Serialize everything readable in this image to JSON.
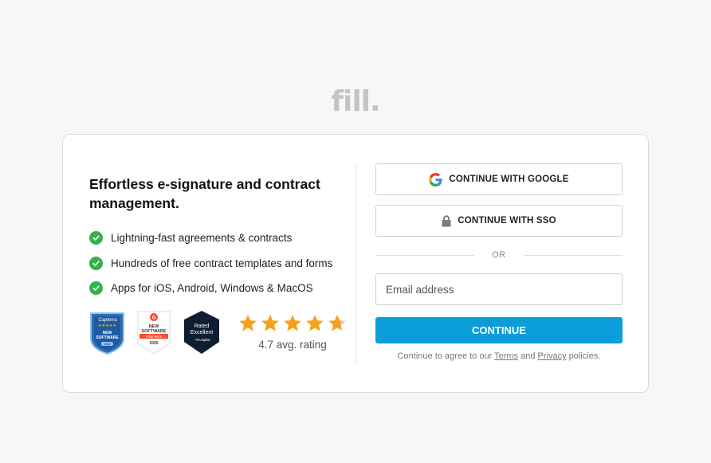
{
  "logo": {
    "text": "fill."
  },
  "headline": "Effortless e-signature and contract management.",
  "features": [
    "Lightning-fast agreements & contracts",
    "Hundreds of free contract templates and forms",
    "Apps for iOS, Android, Windows & MacOS"
  ],
  "badges": {
    "capterra": {
      "brand": "Capterra",
      "line1": "NEW",
      "line2": "SOFTWARE",
      "year": "2024"
    },
    "g2": {
      "line1": "NEW",
      "line2": "SOFTWARE",
      "category": "eSignature",
      "year": "2025"
    },
    "trustpilot": {
      "line1": "Rated",
      "line2": "Excellent",
      "brand": "Trustpilot"
    }
  },
  "rating": {
    "value": 4.7,
    "max": 5,
    "label": "4.7 avg. rating"
  },
  "auth": {
    "google_label": "CONTINUE WITH GOOGLE",
    "sso_label": "CONTINUE WITH SSO",
    "or_text": "OR",
    "email_placeholder": "Email address",
    "continue_label": "CONTINUE",
    "terms_prefix": "Continue to agree to our ",
    "terms_link": "Terms",
    "terms_and": " and ",
    "privacy_link": "Privacy",
    "terms_suffix": " policies."
  },
  "colors": {
    "primary": "#0a9dd9",
    "check": "#33b249",
    "star": "#f5a11a",
    "logo": "#c4c4c4"
  },
  "icons": {
    "google": "google-icon",
    "sso": "lock-icon",
    "feature": "check-circle-icon",
    "star": "star-icon"
  }
}
